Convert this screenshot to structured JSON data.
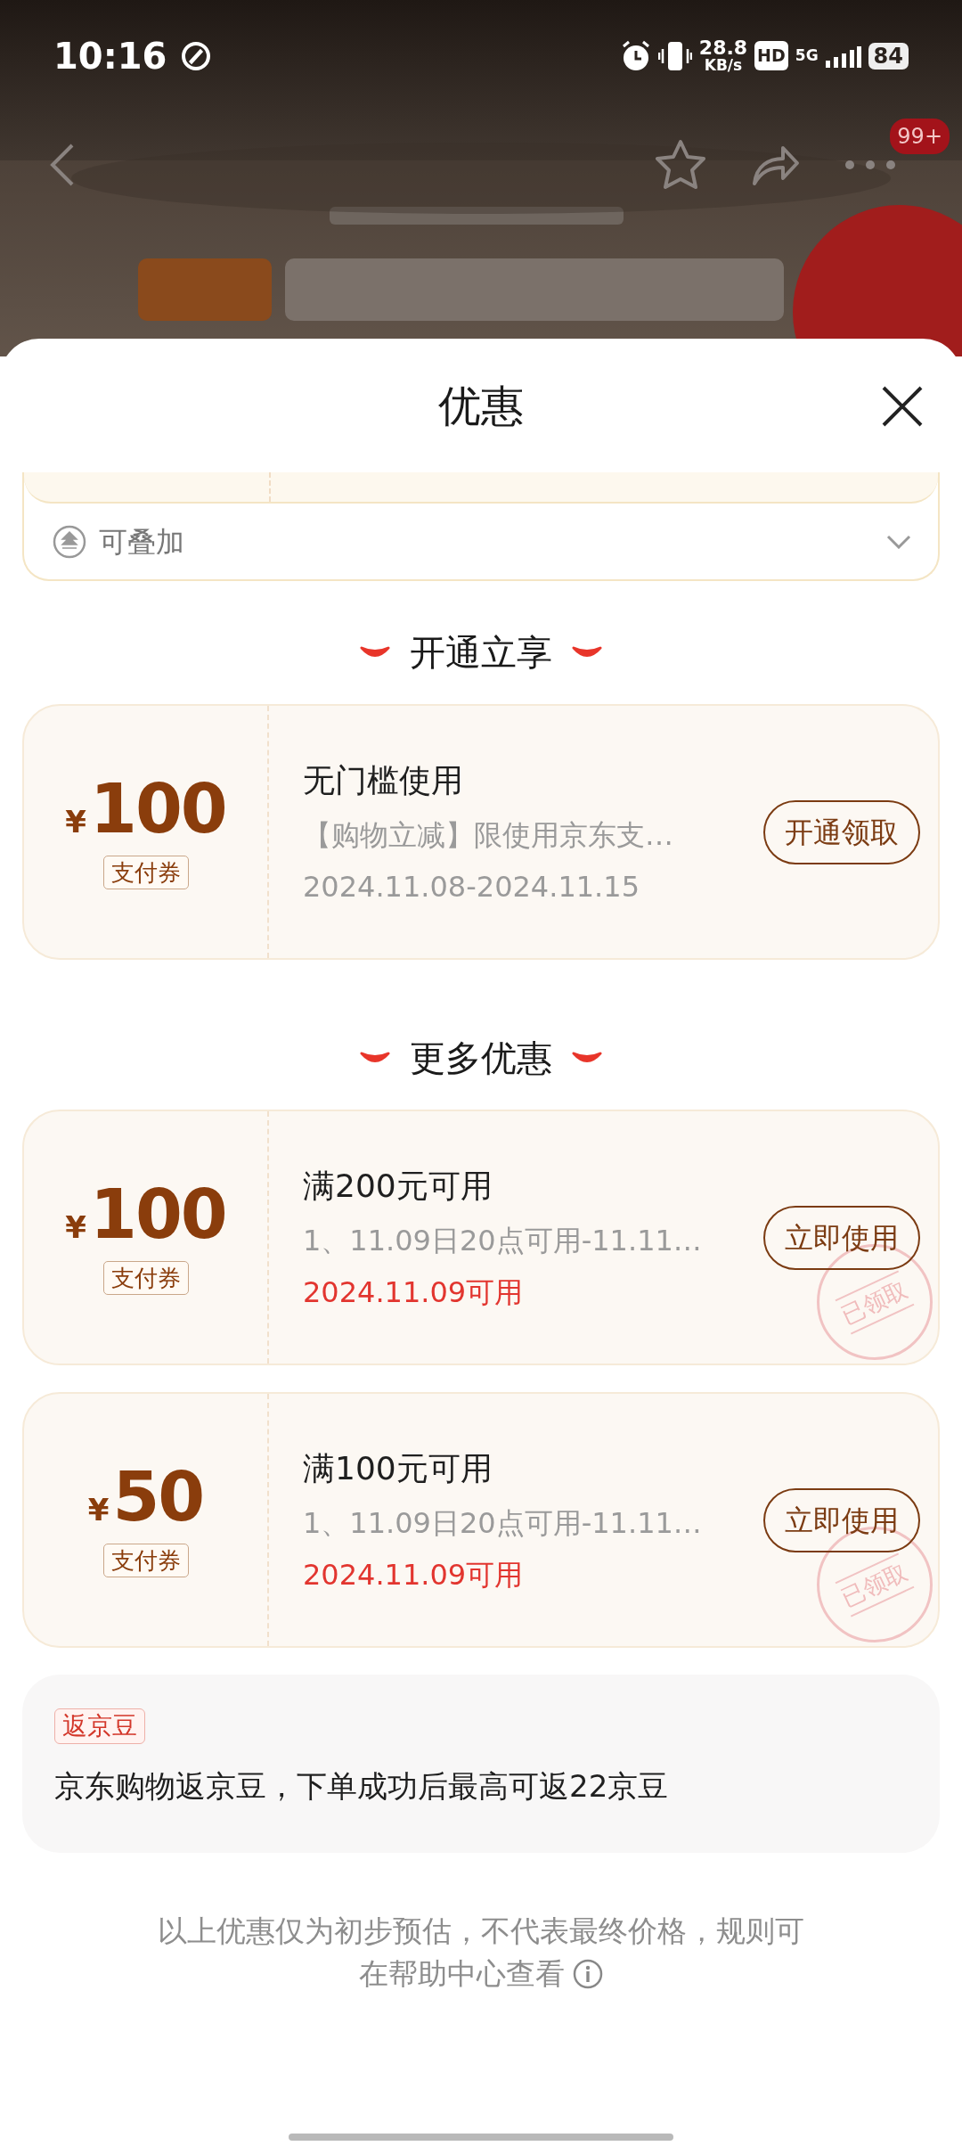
{
  "status_bar": {
    "time": "10:16",
    "net_speed": "28.8",
    "net_unit": "KB/s",
    "hd": "HD",
    "network": "5G",
    "battery": "84"
  },
  "nav": {
    "badge": "99+"
  },
  "sheet": {
    "title": "优惠"
  },
  "stacked_row": {
    "label": "可叠加"
  },
  "sections": [
    {
      "title": "开通立享",
      "coupons": [
        {
          "currency": "¥",
          "amount": "100",
          "type": "支付券",
          "title": "无门槛使用",
          "desc": "【购物立减】限使用京东支…",
          "date": "2024.11.08-2024.11.15",
          "date_highlight": false,
          "button": "开通领取"
        }
      ]
    },
    {
      "title": "更多优惠",
      "coupons": [
        {
          "currency": "¥",
          "amount": "100",
          "type": "支付券",
          "title": "满200元可用",
          "desc": "1、11.09日20点可用-11.11…",
          "date": "2024.11.09可用",
          "date_highlight": true,
          "button": "立即使用",
          "stamp": "已领取"
        },
        {
          "currency": "¥",
          "amount": "50",
          "type": "支付券",
          "title": "满100元可用",
          "desc": "1、11.09日20点可用-11.11…",
          "date": "2024.11.09可用",
          "date_highlight": true,
          "button": "立即使用",
          "stamp": "已领取"
        }
      ]
    }
  ],
  "rebate": {
    "tag": "返京豆",
    "text": "京东购物返京豆，下单成功后最高可返22京豆"
  },
  "footer": {
    "lines": [
      "以上优惠仅为初步预估，不代表最终价格，规则可",
      "在帮助中心查看"
    ]
  }
}
